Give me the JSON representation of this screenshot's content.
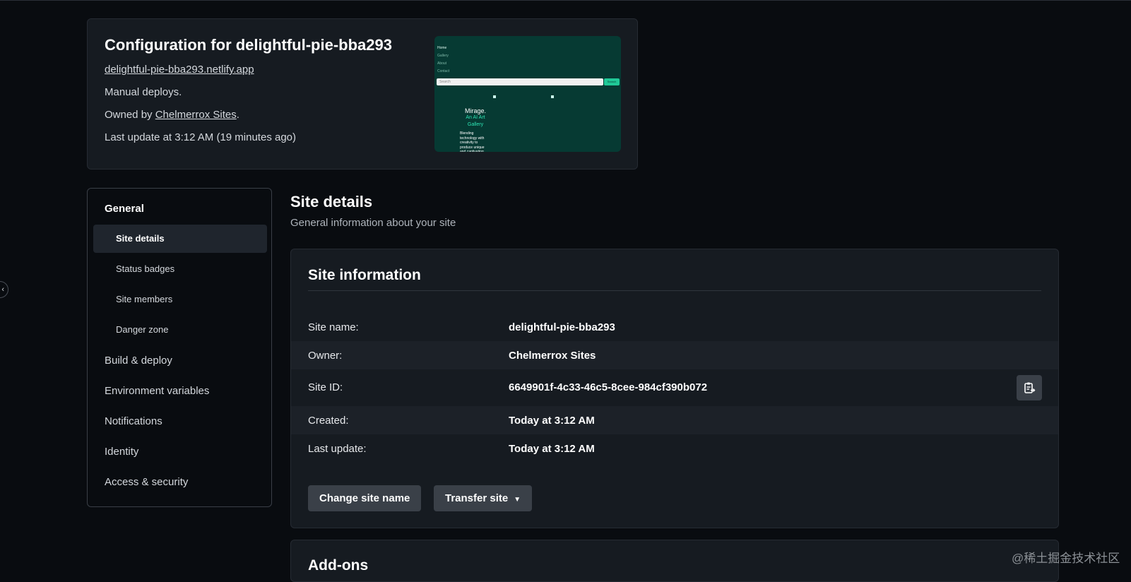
{
  "config": {
    "title": "Configuration for delightful-pie-bba293",
    "url": "delightful-pie-bba293.netlify.app",
    "deploy_mode": "Manual deploys.",
    "owned_prefix": "Owned by ",
    "owner_link": "Chelmerrox Sites",
    "owned_suffix": ".",
    "last_update": "Last update at 3:12 AM (19 minutes ago)"
  },
  "preview": {
    "nav": [
      "Home",
      "Gallery",
      "About",
      "Contact"
    ],
    "search_placeholder": "Search",
    "search_button": "Search",
    "heading": "Mirage.",
    "subheading": "An AI Art Gallery",
    "body": "Blending technology with creativity to produce unique and captivating"
  },
  "sidebar": {
    "group_label": "General",
    "subitems": [
      "Site details",
      "Status badges",
      "Site members",
      "Danger zone"
    ],
    "active_index": 0,
    "items": [
      "Build & deploy",
      "Environment variables",
      "Notifications",
      "Identity",
      "Access & security"
    ]
  },
  "section": {
    "title": "Site details",
    "subtitle": "General information about your site"
  },
  "site_info": {
    "title": "Site information",
    "rows": [
      {
        "label": "Site name:",
        "value": "delightful-pie-bba293"
      },
      {
        "label": "Owner:",
        "value": "Chelmerrox Sites"
      },
      {
        "label": "Site ID:",
        "value": "6649901f-4c33-46c5-8cee-984cf390b072"
      },
      {
        "label": "Created:",
        "value": "Today at 3:12 AM"
      },
      {
        "label": "Last update:",
        "value": "Today at 3:12 AM"
      }
    ],
    "copy_icon": "clipboard-copy-icon",
    "change_name_button": "Change site name",
    "transfer_button": "Transfer site"
  },
  "addons": {
    "title": "Add-ons"
  },
  "watermark": "@稀土掘金技术社区",
  "colors": {
    "background": "#090c10",
    "card": "#161b21",
    "button": "#3a4048",
    "preview_bg": "#063a33",
    "preview_accent": "#20c997"
  }
}
